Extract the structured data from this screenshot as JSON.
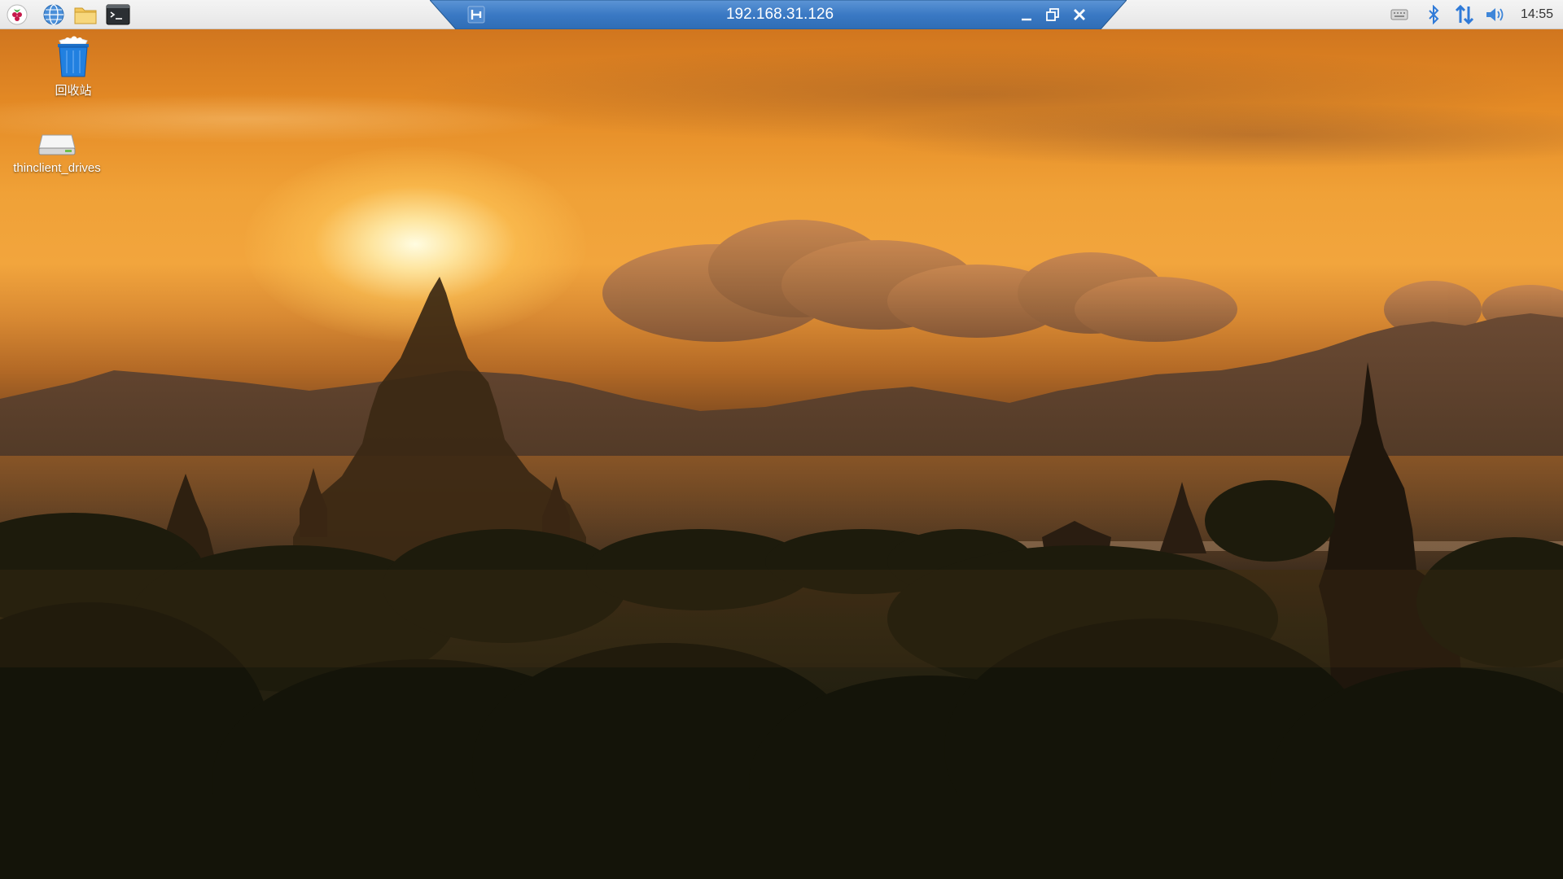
{
  "taskbar": {
    "launchers": [
      {
        "name": "raspberry-menu-icon"
      },
      {
        "name": "web-browser-icon"
      },
      {
        "name": "file-manager-icon"
      },
      {
        "name": "terminal-icon"
      }
    ],
    "tray": {
      "icons": [
        "keyboard-icon",
        "bluetooth-icon",
        "network-icon",
        "volume-icon"
      ],
      "clock": "14:55"
    }
  },
  "remote_session": {
    "title": "192.168.31.126",
    "pin_icon": "pin-icon",
    "buttons": [
      "minimize-icon",
      "restore-icon",
      "close-icon"
    ],
    "colors": {
      "bar": "#2f6db5",
      "bar_light": "#5d95d6"
    }
  },
  "desktop": {
    "icons": [
      {
        "label": "回收站",
        "icon": "trash-icon"
      },
      {
        "label": "thinclient_drives",
        "icon": "drive-icon"
      }
    ]
  },
  "colors": {
    "accent": "#2f6db5",
    "taskbar_bg": "#ececec"
  }
}
